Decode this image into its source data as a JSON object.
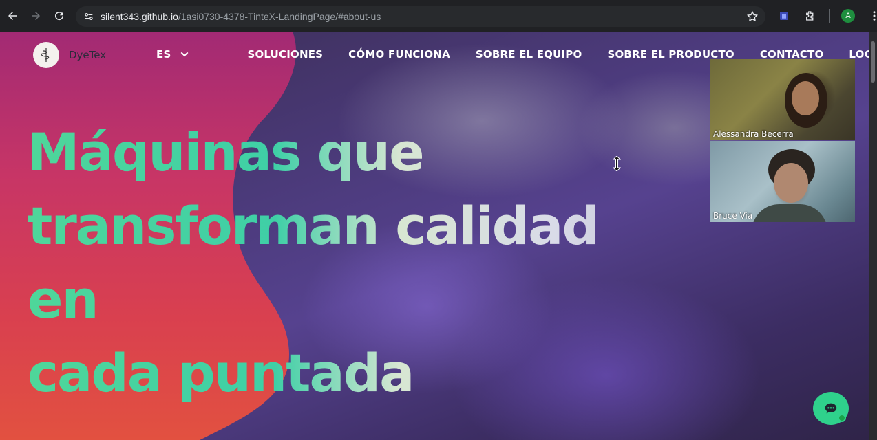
{
  "browser": {
    "url_host": "silent343.github.io",
    "url_path": "/1asi0730-4378-TinteX-LandingPage/#about-us",
    "profile_initial": "A",
    "icons": [
      "back-icon",
      "forward-icon",
      "reload-icon",
      "site-settings-icon",
      "bookmark-star-icon",
      "extension-icon",
      "puzzle-icon"
    ]
  },
  "site": {
    "brand_name": "DyeTex",
    "nav": {
      "language": "ES",
      "items": [
        "SOLUCIONES",
        "CÓMO FUNCIONA",
        "SOBRE EL EQUIPO",
        "SOBRE EL PRODUCTO",
        "CONTACTO",
        "LOGIN"
      ]
    },
    "hero": {
      "line1": "Máquinas que",
      "line2": "transforman calidad en",
      "line3": "cada puntada"
    }
  },
  "video_call": {
    "participants": [
      "Alessandra Becerra",
      "Bruce Via"
    ]
  },
  "colors": {
    "accent_green": "#3fcfa6",
    "blob_top": "#b0305e",
    "blob_bottom": "#e14a3e",
    "chat_button": "#2fd18c"
  }
}
